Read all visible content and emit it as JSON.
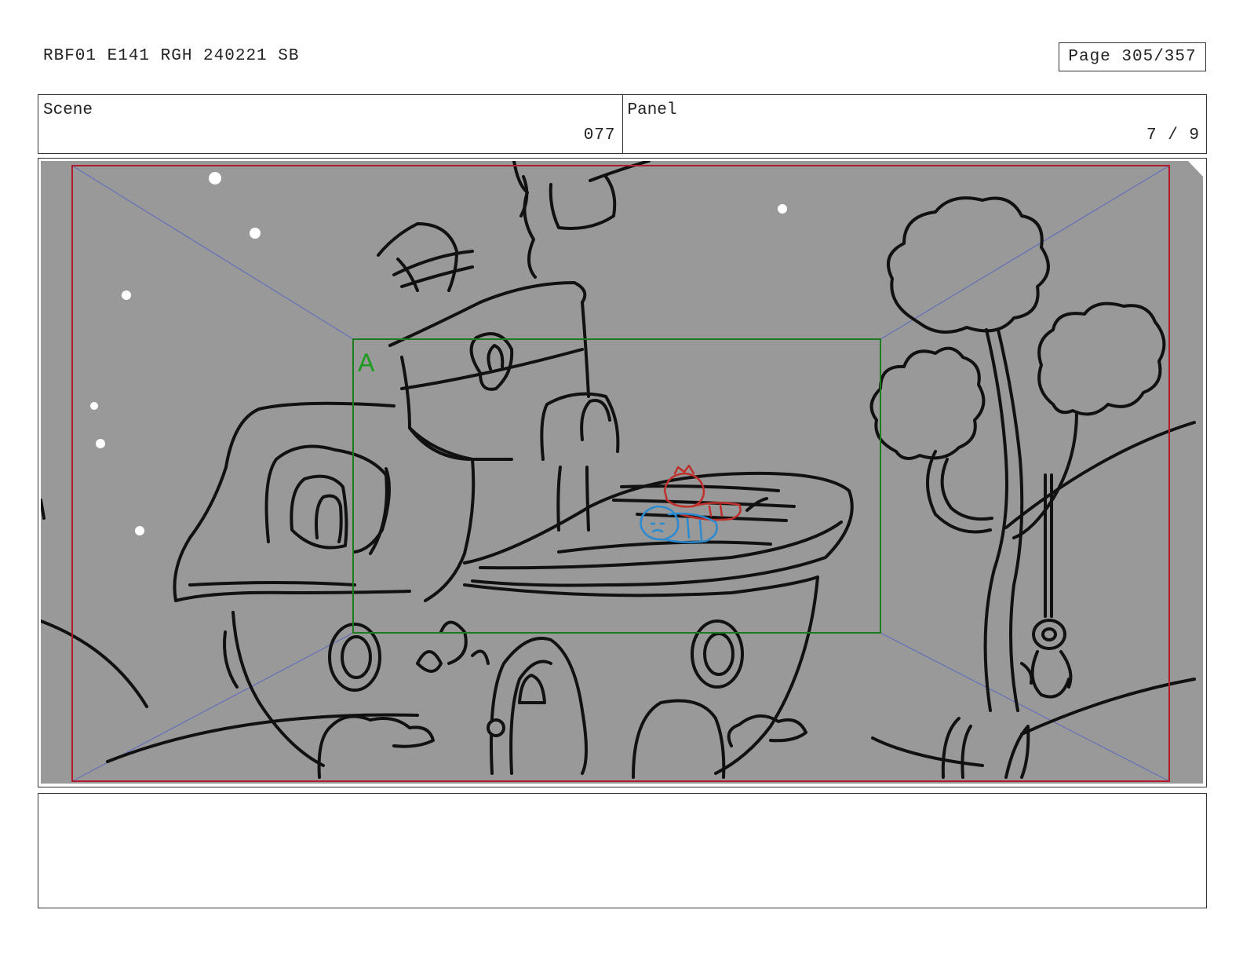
{
  "header": {
    "doc_title": "RBF01 E141 RGH 240221 SB",
    "page_label": "Page 305/357"
  },
  "scene": {
    "label": "Scene",
    "value": "077"
  },
  "panel": {
    "label": "Panel",
    "value": "7 / 9"
  },
  "drawing": {
    "field_marker": "A",
    "colors": {
      "background": "#999999",
      "safe_frame": "#b01c2e",
      "field_guide": "#1e7a1e",
      "diagonals": "#6670b8",
      "character_red": "#c0302a",
      "character_blue": "#2b8ad0",
      "line_art": "#111111"
    }
  },
  "notes": {
    "text": ""
  }
}
